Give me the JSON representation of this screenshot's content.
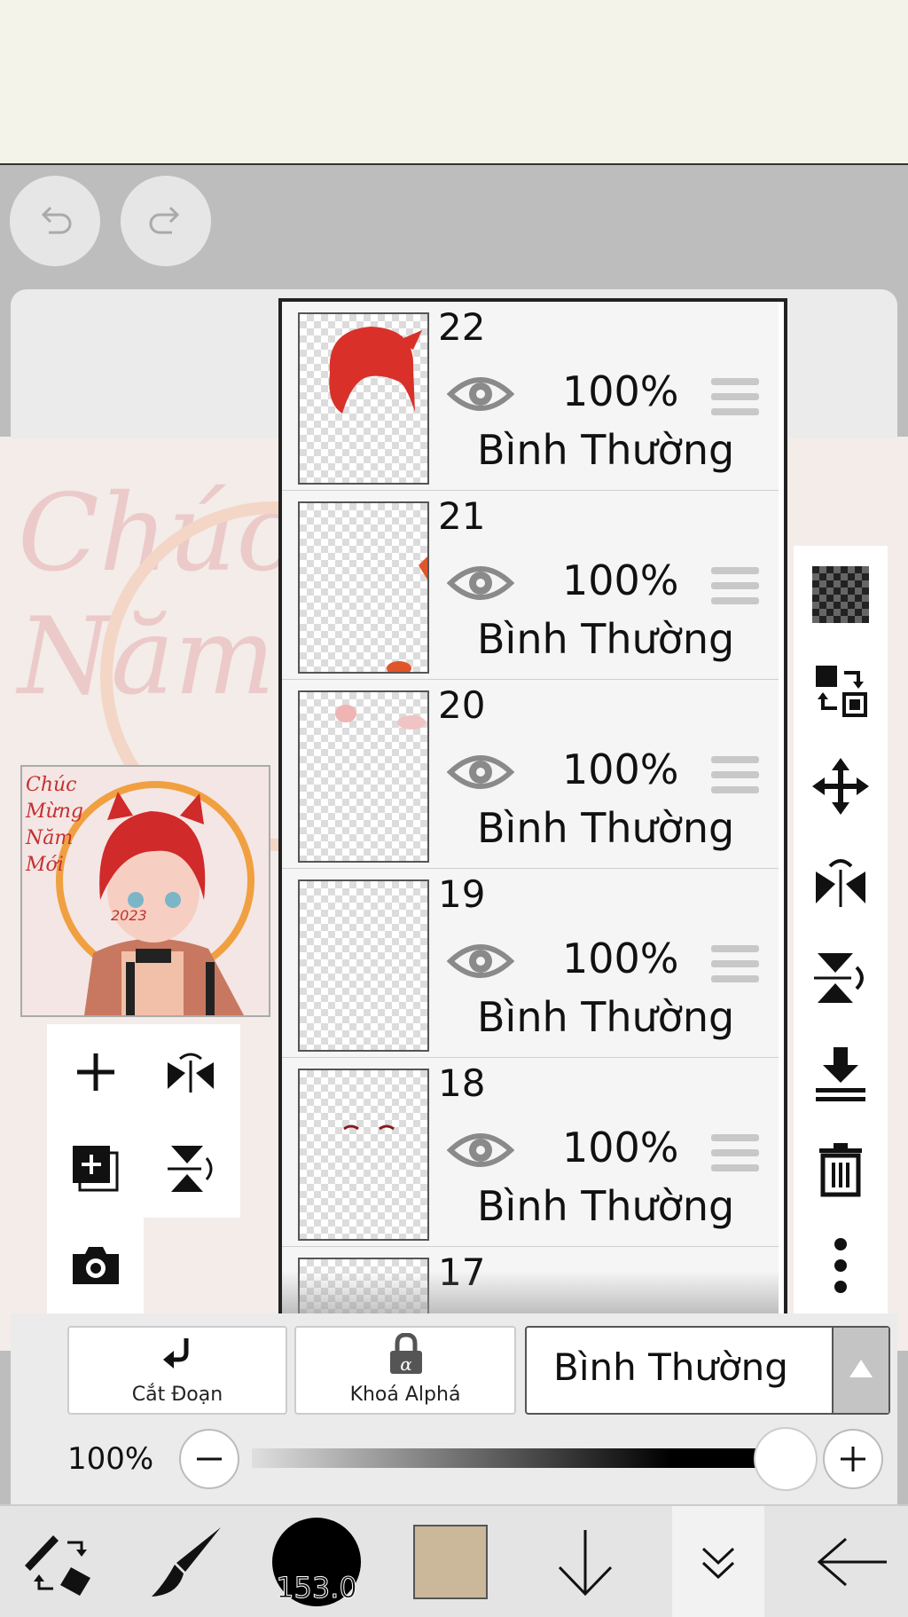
{
  "history": {
    "undo_icon": "undo-icon",
    "redo_icon": "redo-icon"
  },
  "watermark_text": "Chúc Mừng Năm",
  "preview": {
    "text_lines": [
      "Chúc",
      "Mừng",
      "Năm",
      "Mới"
    ],
    "year": "2023"
  },
  "layers": [
    {
      "number": "22",
      "opacity": "100%",
      "blend": "Bình Thường"
    },
    {
      "number": "21",
      "opacity": "100%",
      "blend": "Bình Thường"
    },
    {
      "number": "20",
      "opacity": "100%",
      "blend": "Bình Thường"
    },
    {
      "number": "19",
      "opacity": "100%",
      "blend": "Bình Thường"
    },
    {
      "number": "18",
      "opacity": "100%",
      "blend": "Bình Thường"
    },
    {
      "number": "17"
    }
  ],
  "options": {
    "clipping_label": "Cắt Đoạn",
    "alpha_lock_label": "Khoá Alphá",
    "blend_mode": "Bình Thường"
  },
  "layer_opacity": {
    "text": "100%",
    "value": 1.0
  },
  "toolbar": {
    "brush_size": "153.0",
    "color": "#cbb89a"
  },
  "colors": {
    "accent": "#222222",
    "thumb_red": "#d9312a"
  }
}
